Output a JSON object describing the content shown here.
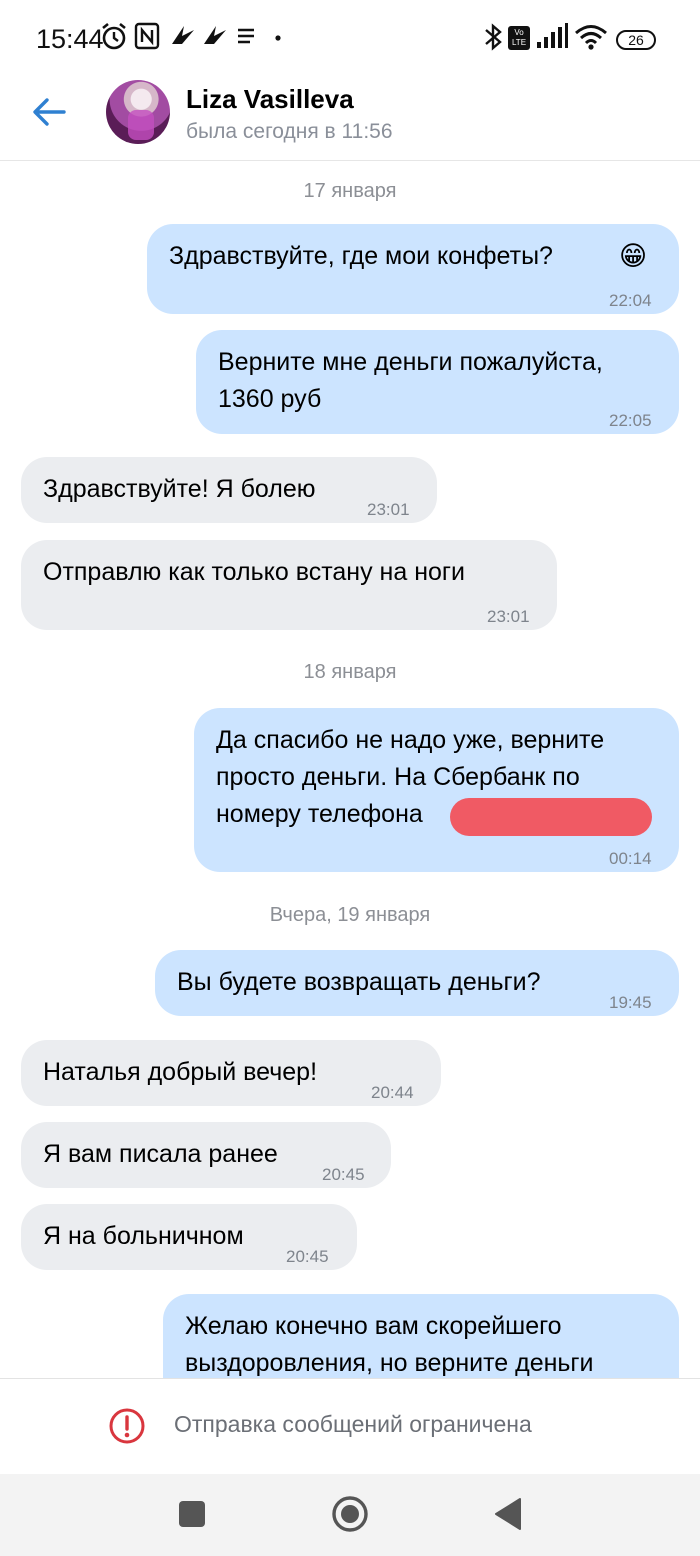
{
  "status_bar": {
    "time": "15:44",
    "network_label": "Vo LTE",
    "battery": "26",
    "icons": [
      "alarm-icon",
      "nfc-icon",
      "app-notification-icon",
      "app-notification-icon",
      "menu-notification-icon",
      "dot-icon",
      "bluetooth-icon",
      "volte-icon",
      "signal-icon",
      "wifi-icon",
      "battery-icon"
    ]
  },
  "header": {
    "contact_name": "Liza Vasilleva",
    "last_seen": "была сегодня в 11:56",
    "back_icon": "arrow-left-icon"
  },
  "chat": {
    "date_1": "17 января",
    "date_2": "18 января",
    "date_3": "Вчера, 19 января",
    "messages": [
      {
        "direction": "outgoing",
        "text": "Здравствуйте, где мои конфеты?",
        "emoji": "😁",
        "time": "22:04"
      },
      {
        "direction": "outgoing",
        "text": "Верните мне деньги пожалуйста,\n1360 руб",
        "time": "22:05"
      },
      {
        "direction": "incoming",
        "text": "Здравствуйте! Я болею",
        "time": "23:01"
      },
      {
        "direction": "incoming",
        "text": "Отправлю как только встану на ноги",
        "time": "23:01"
      },
      {
        "direction": "outgoing",
        "text": "Да спасибо не надо уже, верните\nпросто деньги. На Сбербанк по\nномеру телефона",
        "time": "00:14",
        "redacted": true
      },
      {
        "direction": "outgoing",
        "text": "Вы будете возвращать деньги?",
        "time": "19:45"
      },
      {
        "direction": "incoming",
        "text": "Наталья добрый вечер!",
        "time": "20:44"
      },
      {
        "direction": "incoming",
        "text": "Я вам писала ранее",
        "time": "20:45"
      },
      {
        "direction": "incoming",
        "text": "Я на больничном",
        "time": "20:45"
      },
      {
        "direction": "outgoing",
        "text": "Желаю конечно вам скорейшего\nвыздоровления, но верните деньги"
      }
    ]
  },
  "footer": {
    "restricted_text": "Отправка сообщений ограничена",
    "warning_icon": "warning-circle-icon"
  },
  "colors": {
    "accent": "#2f80d1",
    "outgoing_bubble": "#cce4ff",
    "incoming_bubble": "#ebedf0",
    "warning": "#d9363e"
  },
  "nav": {
    "buttons": [
      "recents-square-icon",
      "home-circle-icon",
      "back-triangle-icon"
    ]
  }
}
